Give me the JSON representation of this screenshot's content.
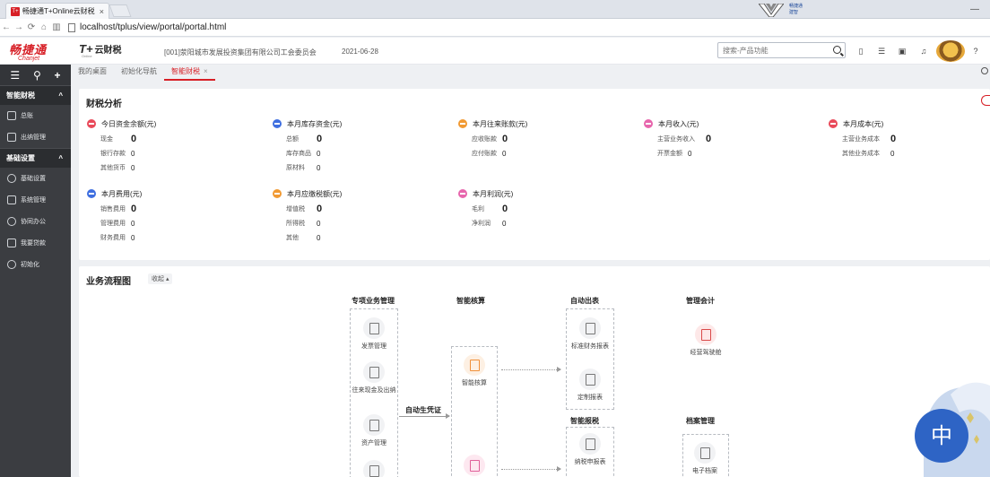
{
  "browser": {
    "tab_title": "畅捷通T+Online云财税",
    "tab_close": "×",
    "url": "localhost/tplus/view/portal/portal.html",
    "favicon_text": "T+",
    "badge_text": "畅捷通 建智",
    "min_glyph": "—"
  },
  "header": {
    "logo_cn": "畅捷通",
    "logo_en": "Chanjet",
    "product_mark": "T+",
    "product_sub": "Online",
    "product_name": "云财税",
    "company": "[001]荥阳城市发展投资集团有限公司工会委员会",
    "date": "2021-06-28",
    "search_placeholder": "搜索-产品功能"
  },
  "sidebar": {
    "groups": [
      {
        "label": "智能财税",
        "items": [
          "总账",
          "出纳管理"
        ]
      },
      {
        "label": "基础设置",
        "items": [
          "基础设置",
          "系统管理",
          "协同办公",
          "我要贷款",
          "初始化"
        ]
      }
    ]
  },
  "tabs": [
    "我的桌面",
    "初始化导航",
    "智能财税"
  ],
  "tab_close": "×",
  "finance": {
    "title": "财税分析",
    "groups": [
      {
        "title": "今日资金余额(元)",
        "color": "#e94a5a",
        "rows": [
          [
            "现金",
            "0"
          ],
          [
            "银行存款",
            "0"
          ],
          [
            "其他货币",
            "0"
          ]
        ]
      },
      {
        "title": "本月库存资金(元)",
        "color": "#3f6fe0",
        "rows": [
          [
            "总额",
            "0"
          ],
          [
            "库存商品",
            "0"
          ],
          [
            "原材料",
            "0"
          ]
        ]
      },
      {
        "title": "本月往来账款(元)",
        "color": "#f19a33",
        "rows": [
          [
            "应收账款",
            "0"
          ],
          [
            "应付账款",
            "0"
          ]
        ]
      },
      {
        "title": "本月收入(元)",
        "color": "#e766ad",
        "rows": [
          [
            "主营业务收入",
            "0"
          ],
          [
            "开票金额",
            "0"
          ]
        ]
      },
      {
        "title": "本月成本(元)",
        "color": "#e94a5a",
        "rows": [
          [
            "主营业务成本",
            "0"
          ],
          [
            "其他业务成本",
            "0"
          ]
        ]
      },
      {
        "title": "本月费用(元)",
        "color": "#3f6fe0",
        "rows": [
          [
            "销售费用",
            "0"
          ],
          [
            "管理费用",
            "0"
          ],
          [
            "财务费用",
            "0"
          ]
        ]
      },
      {
        "title": "本月应缴税额(元)",
        "color": "#f19a33",
        "rows": [
          [
            "增值税",
            "0"
          ],
          [
            "所得税",
            "0"
          ],
          [
            "其他",
            "0"
          ]
        ]
      },
      {
        "title": "本月利润(元)",
        "color": "#e766ad",
        "rows": [
          [
            "毛利",
            "0"
          ],
          [
            "净利润",
            "0"
          ]
        ]
      }
    ]
  },
  "flow": {
    "title": "业务流程图",
    "collapse": "收起 ▴",
    "col_titles": [
      "专项业务管理",
      "智能核算",
      "自动出表",
      "管理会计",
      "智能报税",
      "档案管理"
    ],
    "arrow_label": "自动生凭证",
    "nodes": [
      "发票管理",
      "往来现金及出纳",
      "资产管理",
      "智能核算",
      "标准财务报表",
      "定制报表",
      "经营驾驶舱",
      "纳税申报表",
      "电子档案"
    ]
  },
  "ime": {
    "label": "中"
  }
}
